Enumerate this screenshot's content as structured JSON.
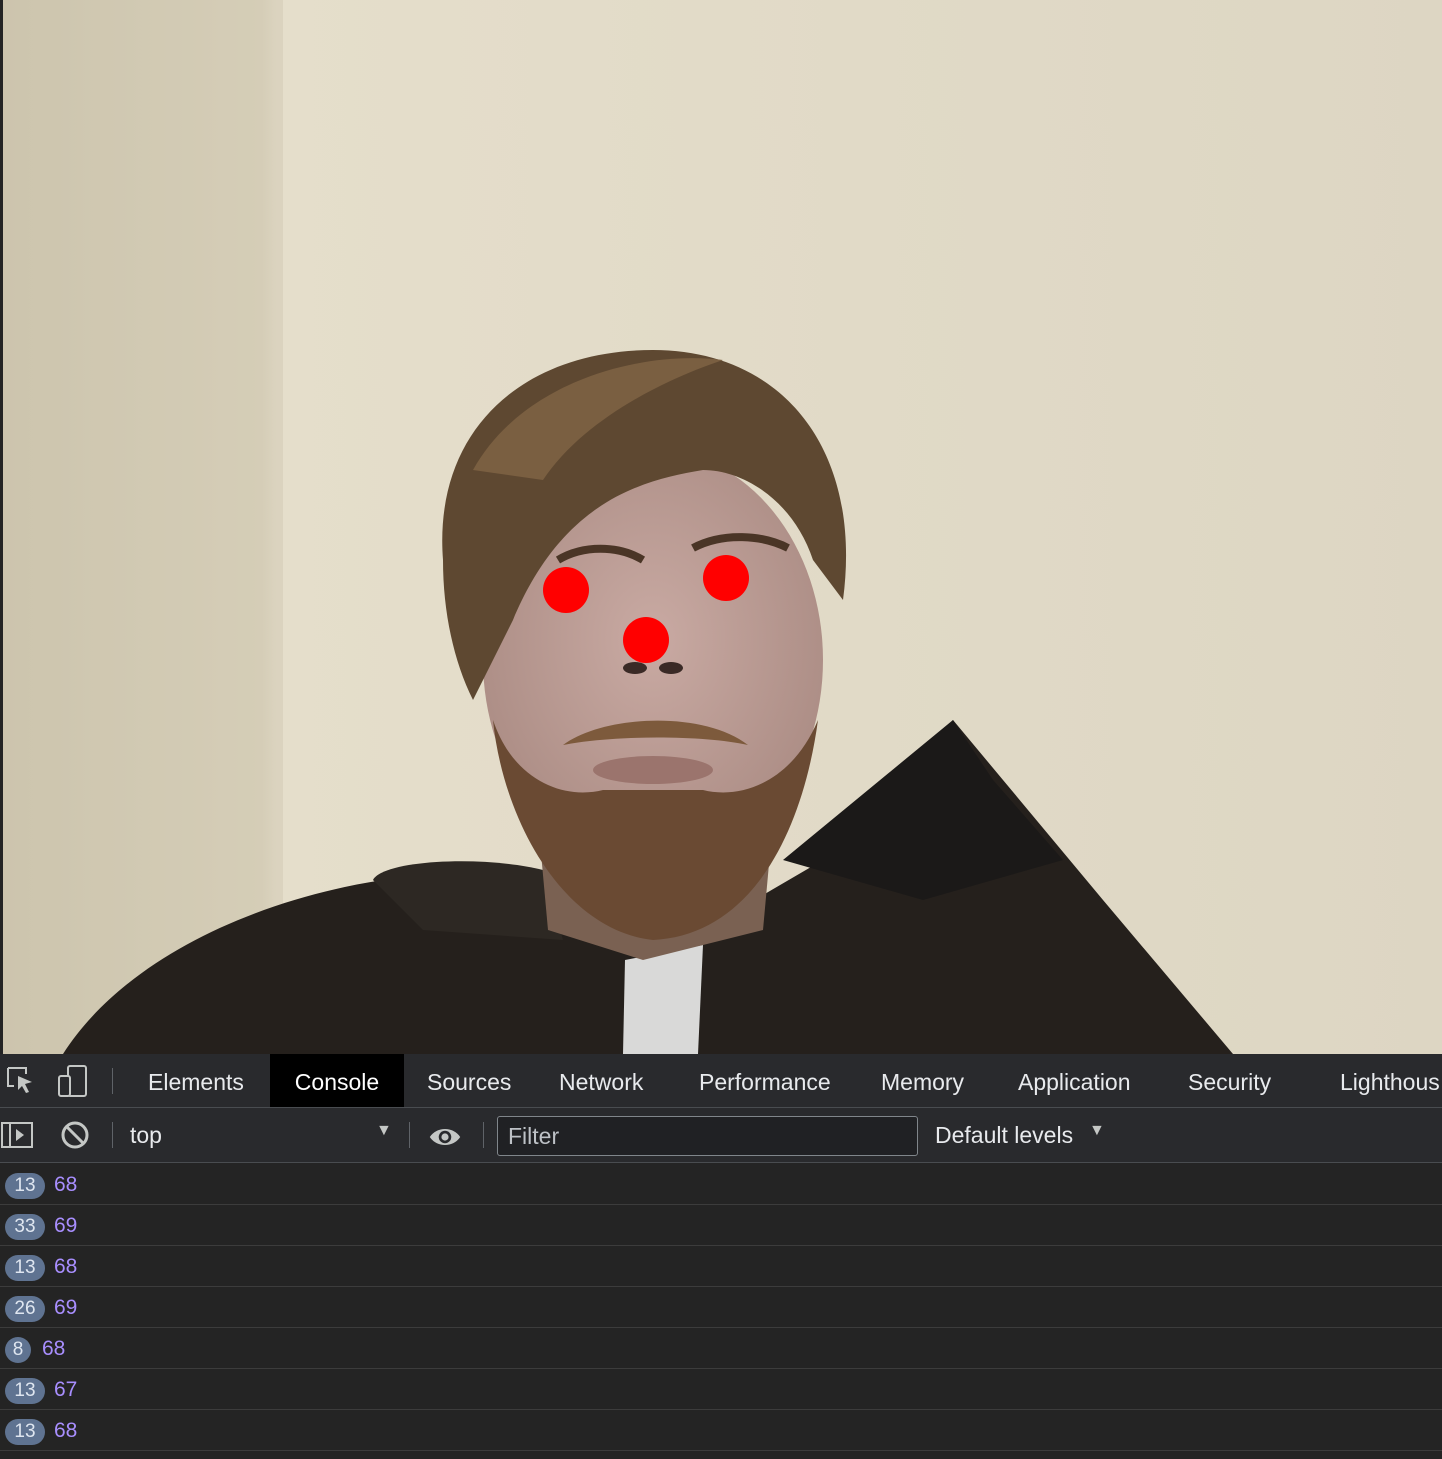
{
  "devtools": {
    "tabs": [
      "Elements",
      "Console",
      "Sources",
      "Network",
      "Performance",
      "Memory",
      "Application",
      "Security",
      "Lighthous"
    ],
    "active_tab": "Console",
    "toolbar": {
      "context": "top",
      "filter_placeholder": "Filter",
      "levels": "Default levels"
    },
    "messages": [
      {
        "count": "13",
        "value": "68"
      },
      {
        "count": "33",
        "value": "69"
      },
      {
        "count": "13",
        "value": "68"
      },
      {
        "count": "26",
        "value": "69"
      },
      {
        "count": "8",
        "value": "68"
      },
      {
        "count": "13",
        "value": "67"
      },
      {
        "count": "13",
        "value": "68"
      }
    ]
  },
  "webcam": {
    "overlay_marker_color": "#ff0000",
    "landmarks": [
      "left-eye",
      "right-eye",
      "nose"
    ]
  },
  "icons": [
    "inspect-element-icon",
    "device-toolbar-icon",
    "sidebar-toggle-icon",
    "clear-console-icon",
    "eye-icon",
    "dropdown-arrow-icon"
  ]
}
